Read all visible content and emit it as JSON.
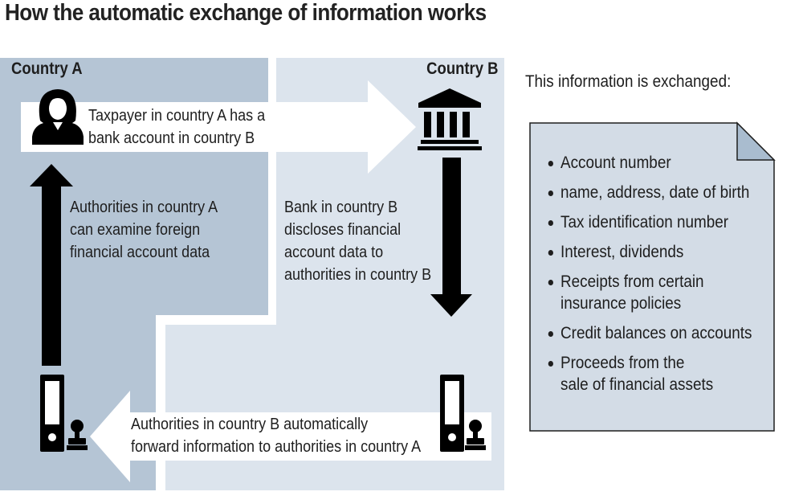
{
  "title": "How the automatic exchange of information works",
  "regions": {
    "a": "Country A",
    "b": "Country B"
  },
  "steps": {
    "taxpayer": [
      "Taxpayer in country A has a",
      "bank account in country B"
    ],
    "bank_discloses": [
      "Bank in country B",
      "discloses financial",
      "account data to",
      "authorities in country B"
    ],
    "forward": [
      "Authorities in country B automatically",
      "forward information to authorities in country A"
    ],
    "authorities_a": [
      "Authorities in country A",
      "can examine foreign",
      "financial account data"
    ]
  },
  "info_panel": {
    "intro": "This information is exchanged:",
    "items": [
      [
        "Account number"
      ],
      [
        "name, address, date of birth"
      ],
      [
        "Tax identification number"
      ],
      [
        "Interest, dividends"
      ],
      [
        "Receipts from certain",
        "insurance policies"
      ],
      [
        "Credit balances on accounts"
      ],
      [
        "Proceeds from the",
        "sale of financial assets"
      ]
    ]
  },
  "icons": [
    "taxpayer-icon",
    "bank-icon",
    "folder-icon",
    "stamp-icon",
    "document-icon"
  ],
  "colors": {
    "country_a": "#b5c5d5",
    "country_b": "#dce4ed",
    "document": "#d3dce6",
    "document_fold": "#a9bccf",
    "arrow_dark": "#000000",
    "arrow_light": "#ffffff"
  }
}
